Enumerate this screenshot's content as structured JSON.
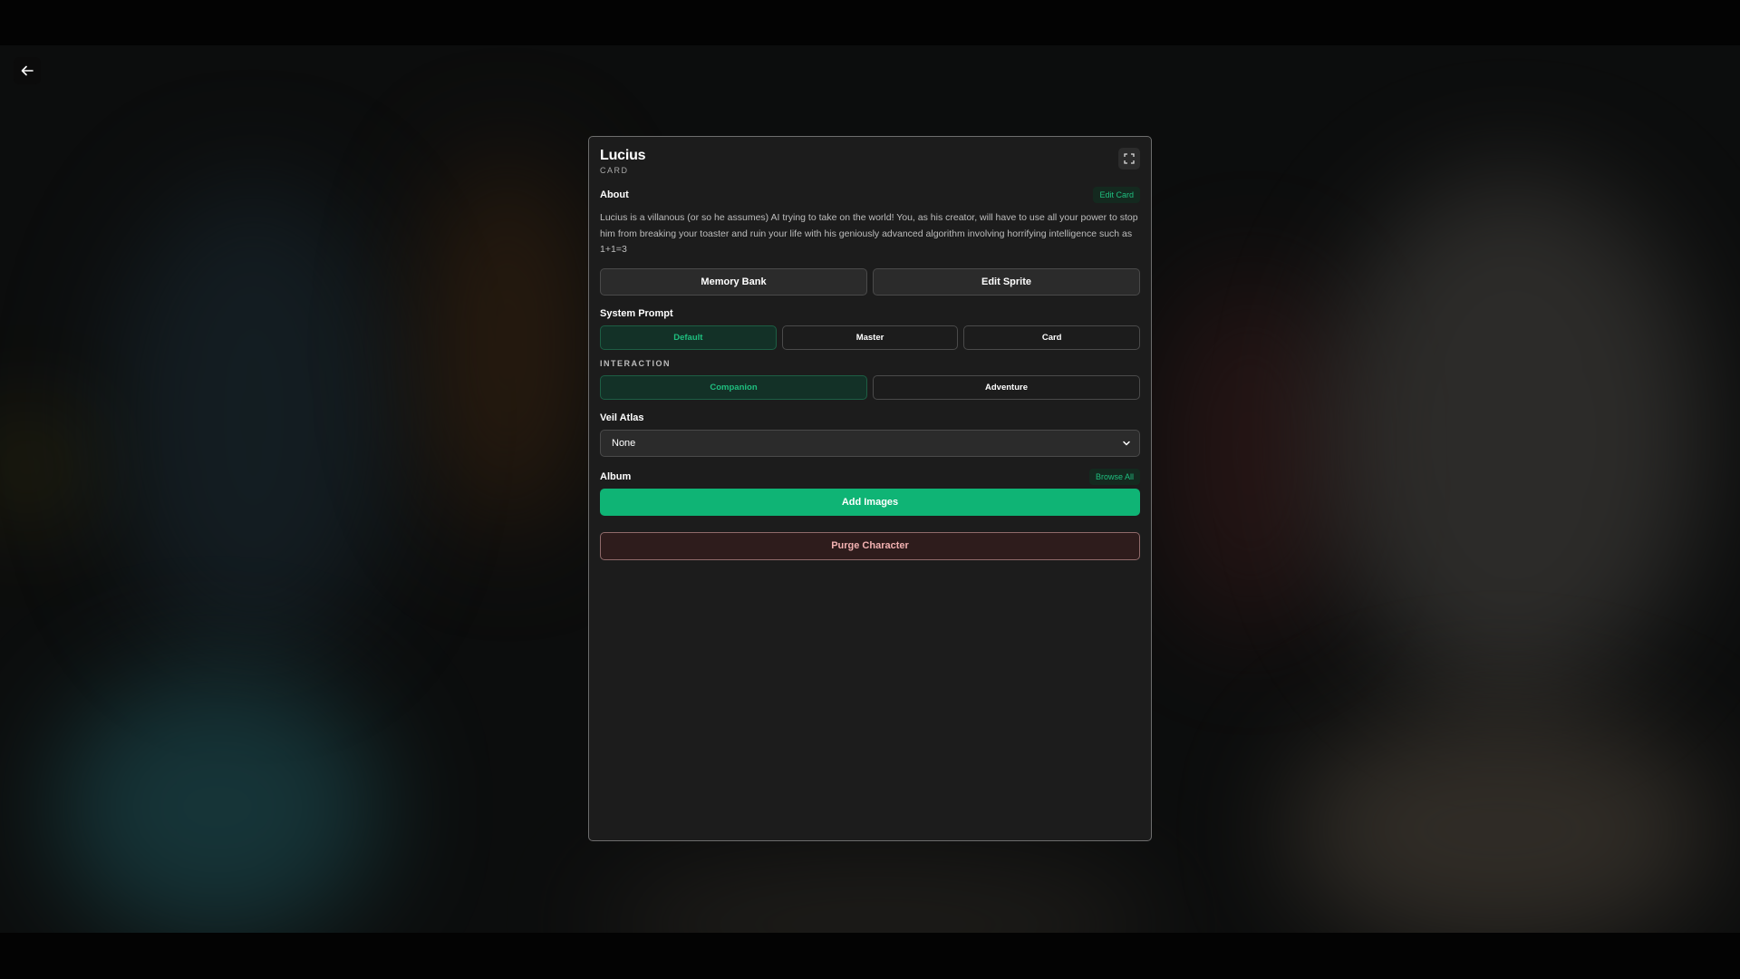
{
  "character": {
    "name": "Lucius",
    "type": "CARD"
  },
  "about": {
    "label": "About",
    "edit_label": "Edit Card",
    "text": "Lucius is a villanous (or so he assumes) AI trying to take on the world! You, as his creator, will have to use all your power to stop him from breaking your toaster and ruin your life with his geniously advanced algorithm involving horrifying intelligence such as 1+1=3"
  },
  "actions": {
    "memory_bank": "Memory Bank",
    "edit_sprite": "Edit Sprite"
  },
  "system_prompt": {
    "label": "System Prompt",
    "options": [
      "Default",
      "Master",
      "Card"
    ],
    "selected": "Default"
  },
  "interaction": {
    "label": "INTERACTION",
    "options": [
      "Companion",
      "Adventure"
    ],
    "selected": "Companion"
  },
  "veil_atlas": {
    "label": "Veil Atlas",
    "value": "None"
  },
  "album": {
    "label": "Album",
    "browse_label": "Browse All",
    "add_label": "Add Images"
  },
  "purge_label": "Purge Character",
  "colors": {
    "accent": "#0fb475",
    "accent_text": "#1fbf7f",
    "panel": "#1c1c1c",
    "danger_text": "#f2b1b1"
  }
}
